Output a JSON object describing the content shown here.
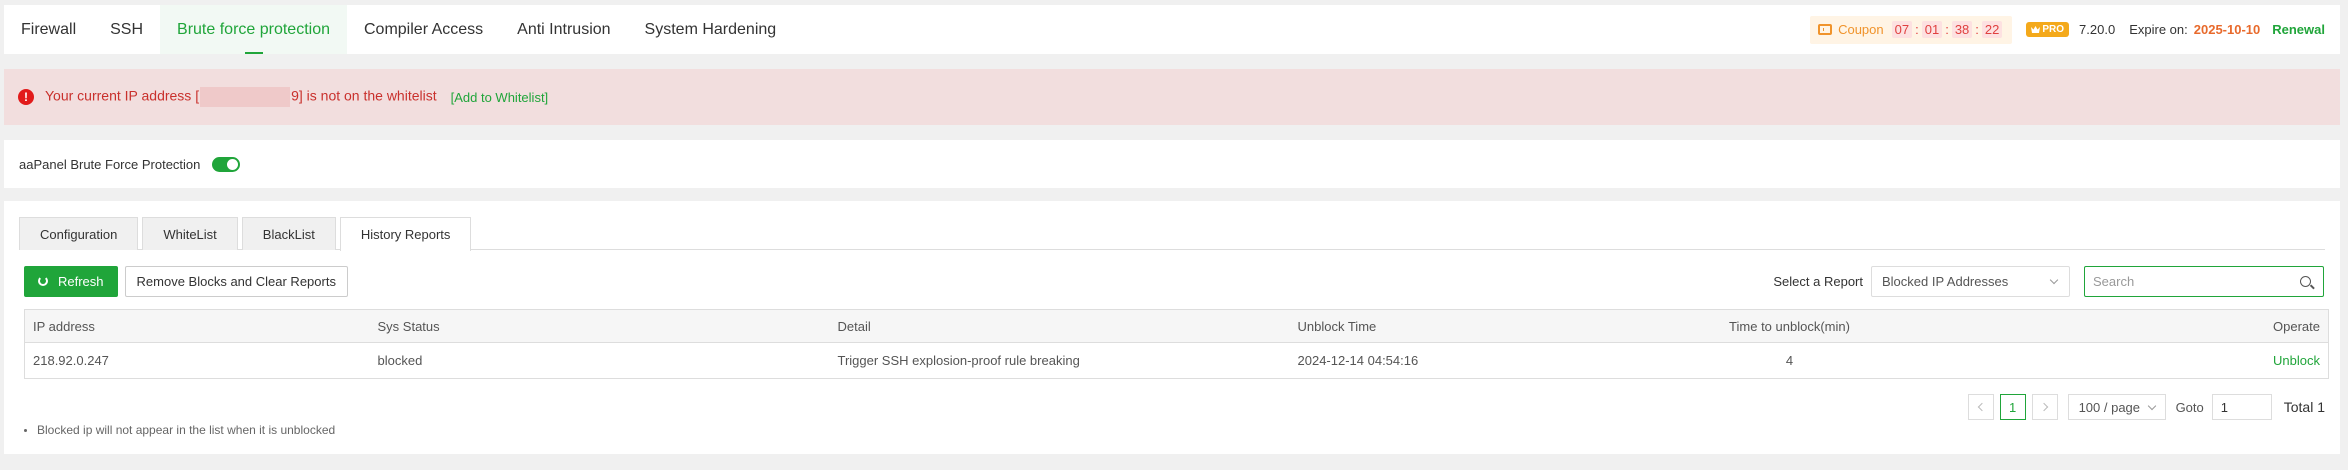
{
  "nav": {
    "tabs": [
      {
        "label": "Firewall"
      },
      {
        "label": "SSH"
      },
      {
        "label": "Brute force protection",
        "active": true
      },
      {
        "label": "Compiler Access"
      },
      {
        "label": "Anti Intrusion"
      },
      {
        "label": "System Hardening"
      }
    ]
  },
  "header": {
    "coupon_label": "Coupon",
    "timer": [
      "07",
      "01",
      "38",
      "22"
    ],
    "timer_sep": ":",
    "pro_label": "PRO",
    "version": "7.20.0",
    "expire_label": "Expire on:",
    "expire_date": "2025-10-10",
    "renewal_label": "Renewal"
  },
  "alert": {
    "icon": "!",
    "text_before": "Your current IP address [",
    "text_after": "9] is not on the whitelist",
    "link": "[Add to Whitelist]"
  },
  "protection": {
    "label": "aaPanel Brute Force Protection",
    "enabled": true
  },
  "subtabs": [
    {
      "label": "Configuration"
    },
    {
      "label": "WhiteList"
    },
    {
      "label": "BlackList"
    },
    {
      "label": "History Reports",
      "active": true
    }
  ],
  "toolbar": {
    "refresh_label": "Refresh",
    "remove_label": "Remove Blocks and Clear Reports",
    "select_label": "Select a Report",
    "select_value": "Blocked IP Addresses",
    "search_placeholder": "Search"
  },
  "table": {
    "headers": [
      "IP address",
      "Sys Status",
      "Detail",
      "Unblock Time",
      "Time to unblock(min)",
      "Operate"
    ],
    "rows": [
      {
        "ip": "218.92.0.247",
        "status": "blocked",
        "detail": "Trigger SSH explosion-proof rule breaking",
        "unblock_time": "2024-12-14 04:54:16",
        "minutes": "4",
        "action": "Unblock"
      }
    ]
  },
  "pagination": {
    "current_page": "1",
    "page_size": "100 / page",
    "goto_label": "Goto",
    "goto_value": "1",
    "total": "Total 1"
  },
  "note": "Blocked ip will not appear in the list when it is unblocked",
  "colors": {
    "accent": "#20a53a",
    "alert_bg": "#f2dede",
    "alert_text": "#c9302c",
    "expire": "#e86a2c",
    "coupon": "#f0932b"
  }
}
